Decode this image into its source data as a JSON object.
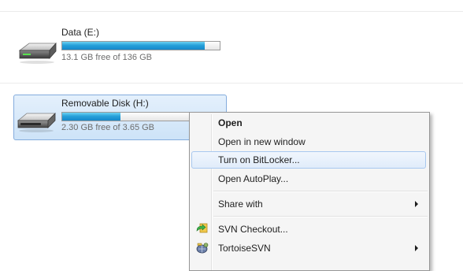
{
  "drives": [
    {
      "name": "Data (E:)",
      "free_text": "13.1 GB free of 136 GB",
      "used_fraction": 0.904,
      "selected": false,
      "icon": "hard-drive-icon"
    },
    {
      "name": "Removable Disk (H:)",
      "free_text": "2.30 GB free of 3.65 GB",
      "used_fraction": 0.37,
      "selected": true,
      "icon": "removable-drive-icon"
    }
  ],
  "context_menu": {
    "items": [
      {
        "label": "Open",
        "bold": true
      },
      {
        "label": "Open in new window"
      },
      {
        "label": "Turn on BitLocker...",
        "highlighted": true
      },
      {
        "label": "Open AutoPlay..."
      },
      {
        "label": "Share with",
        "submenu": true
      },
      {
        "label": "SVN Checkout...",
        "icon": "svn-checkout-icon"
      },
      {
        "label": "TortoiseSVN",
        "icon": "tortoisesvn-icon",
        "submenu": true
      }
    ]
  },
  "colors": {
    "capacity_fill": "#26a0da",
    "selection_background": "#cde3f8",
    "selection_border": "#84acdd",
    "menu_background": "#f5f5f5"
  }
}
